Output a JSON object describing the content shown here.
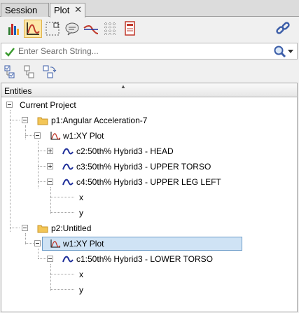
{
  "tabs": [
    {
      "label": "Session"
    },
    {
      "label": "Plot",
      "close": "✕"
    }
  ],
  "toolbar": {
    "items": [
      "bar-chart-icon",
      "xy-plot-icon",
      "grid-icon",
      "note-icon",
      "curve-icon",
      "table-icon",
      "document-icon",
      "link-icon"
    ]
  },
  "search": {
    "placeholder": "Enter Search String..."
  },
  "tree": {
    "header": "Entities",
    "root": "Current Project",
    "p1": {
      "label": "p1:Angular Acceleration-7"
    },
    "w1a": {
      "label": "w1:XY Plot"
    },
    "c2": {
      "label": "c2:50th% Hybrid3   - HEAD"
    },
    "c3": {
      "label": "c3:50th% Hybrid3   - UPPER TORSO"
    },
    "c4": {
      "label": "c4:50th% Hybrid3   - UPPER LEG LEFT"
    },
    "x1": {
      "label": "x"
    },
    "y1": {
      "label": "y"
    },
    "p2": {
      "label": "p2:Untitled"
    },
    "w1b": {
      "label": "w1:XY Plot"
    },
    "c1": {
      "label": "c1:50th% Hybrid3   - LOWER TORSO"
    },
    "x2": {
      "label": "x"
    },
    "y2": {
      "label": "y"
    }
  },
  "colors": {
    "selection": "#cfe3f5",
    "curve": "#1f2f9a",
    "plot_icon": "#c0392b",
    "folder": "#e8b84a"
  }
}
